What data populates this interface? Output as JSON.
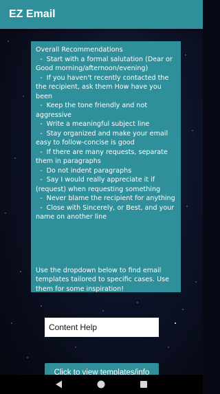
{
  "app": {
    "title": "EZ Email"
  },
  "recommendations": {
    "title": "Overall Recommendations",
    "items": [
      "  -  Start with a formal salutation (Dear or Good morning/afternoon/evening)",
      "  -  If you haven't recently contacted the the recipient, ask them How have you been",
      "  -  Keep the tone friendly and not aggressive",
      "  -  Write a meaningful subject line",
      "  -  Stay organized and make your email easy to follow-concise is good",
      "  -  If there are many requests, separate them in paragraphs",
      "  -  Do not indent paragraphs",
      "  -  Say I would really appreciate it if (request) when requesting something",
      "  -  Never blame the recipient for anything",
      "  -  Close with Sincerely, or Best, and your name on another line"
    ],
    "footer": "Use the dropdown below to find email templates tailored to specific cases. Use them for some inspiration!"
  },
  "dropdown": {
    "selected": "Content Help"
  },
  "button": {
    "label": "Click to view templates/info"
  },
  "nav": {
    "back_icon": "back-triangle-icon",
    "home_icon": "home-circle-icon",
    "recents_icon": "recents-square-icon"
  },
  "colors": {
    "accent": "#2f8f9a",
    "nav_background": "#000000"
  }
}
